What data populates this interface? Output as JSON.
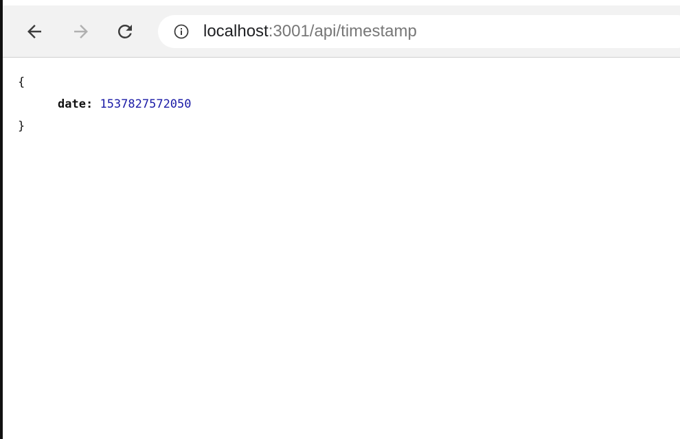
{
  "browser": {
    "url_host": "localhost",
    "url_rest": ":3001/api/timestamp",
    "icons": {
      "back": "back-arrow-icon",
      "forward": "forward-arrow-icon",
      "reload": "reload-icon",
      "info": "info-icon"
    }
  },
  "json_view": {
    "open_brace": "{",
    "key": "date",
    "separator": ":",
    "value": "1537827572050",
    "close_brace": "}"
  },
  "colors": {
    "toolbar_bg": "#f2f2f2",
    "number": "#1a1aa6",
    "url_muted": "#777777",
    "url_host": "#202124"
  }
}
